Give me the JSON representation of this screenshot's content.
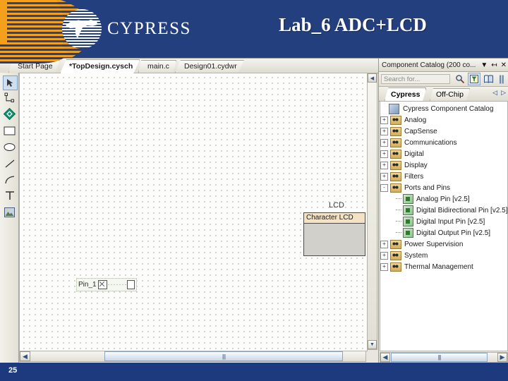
{
  "slide": {
    "title": "Lab_6 ADC+LCD",
    "brand": "CYPRESS",
    "page_number": "25",
    "colors": {
      "header_blue": "#243f7d",
      "accent_orange": "#f5a01b",
      "footer_blue": "#1c3a7d",
      "selection_blue": "#cddff0",
      "component_header_tan": "#f3e3c4"
    }
  },
  "editor": {
    "tabs": [
      {
        "label": "Start Page",
        "active": false
      },
      {
        "label": "*TopDesign.cysch",
        "active": true
      },
      {
        "label": "main.c",
        "active": false
      },
      {
        "label": "Design01.cydwr",
        "active": false
      }
    ],
    "toolbar": [
      {
        "name": "select-tool",
        "icon": "cursor-arrow-icon",
        "selected": true
      },
      {
        "name": "wire-tool",
        "icon": "wire-icon",
        "selected": false
      },
      {
        "name": "component-tool",
        "icon": "green-diamond-icon",
        "selected": false
      },
      {
        "name": "rectangle-tool",
        "icon": "rectangle-icon",
        "selected": false
      },
      {
        "name": "ellipse-tool",
        "icon": "ellipse-icon",
        "selected": false
      },
      {
        "name": "line-tool",
        "icon": "line-icon",
        "selected": false
      },
      {
        "name": "arc-tool",
        "icon": "arc-icon",
        "selected": false
      },
      {
        "name": "text-tool",
        "icon": "text-t-icon",
        "selected": false
      },
      {
        "name": "image-tool",
        "icon": "picture-icon",
        "selected": false
      }
    ],
    "canvas": {
      "lcd": {
        "instance_label": "LCD",
        "component_name": "Character LCD"
      },
      "pin": {
        "label": "Pin_1"
      }
    },
    "scroll": {
      "left_arrow": "◀",
      "right_arrow": "▶",
      "up_arrow": "▲",
      "down_arrow": "▼",
      "grip": "||||"
    }
  },
  "catalog": {
    "title": "Component Catalog (200 co...",
    "title_icons": {
      "dropdown": "▼",
      "pin": "↤",
      "close": "✕"
    },
    "search": {
      "placeholder": "Search for...",
      "icons": [
        {
          "name": "find-icon",
          "glyph": "🔍",
          "boxed": false
        },
        {
          "name": "filter-icon",
          "glyph": "▽",
          "boxed": true
        },
        {
          "name": "book-icon",
          "glyph": "📖",
          "boxed": false
        },
        {
          "name": "list-icon",
          "glyph": "‖",
          "boxed": false
        }
      ]
    },
    "tabs": [
      {
        "label": "Cypress",
        "active": true
      },
      {
        "label": "Off-Chip",
        "active": false
      }
    ],
    "nav": {
      "prev": "◁",
      "next": "▷"
    },
    "tree": [
      {
        "label": "Cypress Component Catalog",
        "icon": "catalog-root-icon",
        "level": 0,
        "expander": "none"
      },
      {
        "label": "Analog",
        "icon": "folder-icon",
        "level": 1,
        "expander": "+"
      },
      {
        "label": "CapSense",
        "icon": "folder-icon",
        "level": 1,
        "expander": "+"
      },
      {
        "label": "Communications",
        "icon": "folder-icon",
        "level": 1,
        "expander": "+"
      },
      {
        "label": "Digital",
        "icon": "folder-icon",
        "level": 1,
        "expander": "+"
      },
      {
        "label": "Display",
        "icon": "folder-icon",
        "level": 1,
        "expander": "+"
      },
      {
        "label": "Filters",
        "icon": "folder-icon",
        "level": 1,
        "expander": "+"
      },
      {
        "label": "Ports and Pins",
        "icon": "folder-icon",
        "level": 1,
        "expander": "-"
      },
      {
        "label": "Analog Pin [v2.5]",
        "icon": "pin-component-icon",
        "level": 2,
        "expander": "none"
      },
      {
        "label": "Digital Bidirectional Pin [v2.5]",
        "icon": "pin-component-icon",
        "level": 2,
        "expander": "none"
      },
      {
        "label": "Digital Input Pin [v2.5]",
        "icon": "pin-component-icon",
        "level": 2,
        "expander": "none"
      },
      {
        "label": "Digital Output Pin [v2.5]",
        "icon": "pin-component-icon",
        "level": 2,
        "expander": "none"
      },
      {
        "label": "Power Supervision",
        "icon": "folder-icon",
        "level": 1,
        "expander": "+"
      },
      {
        "label": "System",
        "icon": "folder-icon",
        "level": 1,
        "expander": "+"
      },
      {
        "label": "Thermal Management",
        "icon": "folder-icon",
        "level": 1,
        "expander": "+"
      }
    ]
  }
}
